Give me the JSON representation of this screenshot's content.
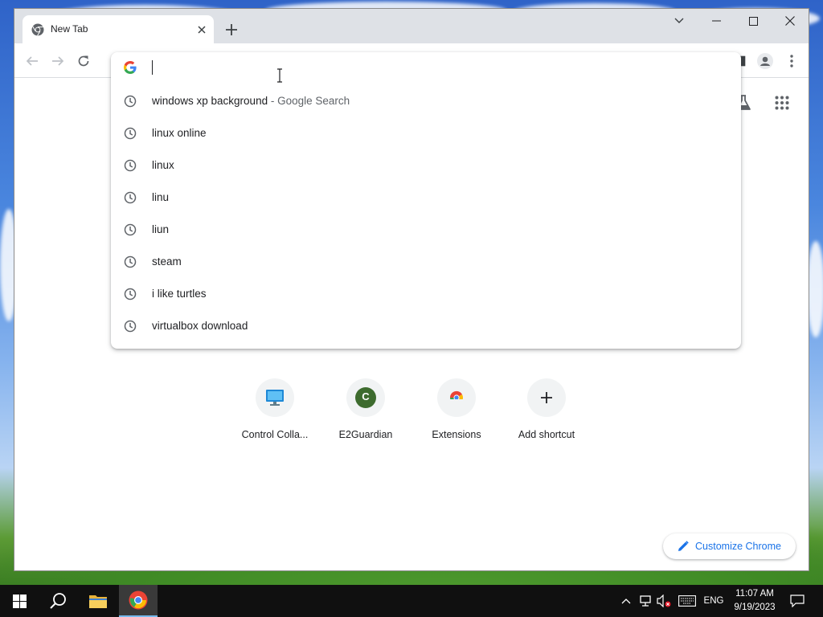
{
  "browser": {
    "tab": {
      "title": "New Tab"
    },
    "window_controls": [
      "tab-search",
      "minimize",
      "maximize",
      "close"
    ]
  },
  "omnibox": {
    "value": "",
    "suggestions": [
      {
        "text": "windows xp background",
        "separator": "-",
        "suffix": "Google Search",
        "icon": "history-clock-icon"
      },
      {
        "text": "linux online",
        "icon": "history-clock-icon"
      },
      {
        "text": "linux",
        "icon": "history-clock-icon"
      },
      {
        "text": "linu",
        "icon": "history-clock-icon"
      },
      {
        "text": "liun",
        "icon": "history-clock-icon"
      },
      {
        "text": "steam",
        "icon": "history-clock-icon"
      },
      {
        "text": "i like turtles",
        "icon": "history-clock-icon"
      },
      {
        "text": "virtualbox download",
        "icon": "history-clock-icon"
      }
    ]
  },
  "shortcuts": [
    {
      "label": "Control Colla...",
      "icon": "monitor-icon"
    },
    {
      "label": "E2Guardian",
      "icon": "letter-avatar-icon",
      "letter": "C",
      "color": "#3d6b2e"
    },
    {
      "label": "Extensions",
      "icon": "chrome-icon"
    },
    {
      "label": "Add shortcut",
      "icon": "plus-icon"
    }
  ],
  "customize": {
    "label": "Customize Chrome"
  },
  "taskbar": {
    "language": "ENG",
    "clock": {
      "time": "11:07 AM",
      "date": "9/19/2023"
    }
  },
  "colors": {
    "accent": "#1a73e8",
    "tab_strip": "#dee1e6",
    "taskbar": "#101010"
  }
}
